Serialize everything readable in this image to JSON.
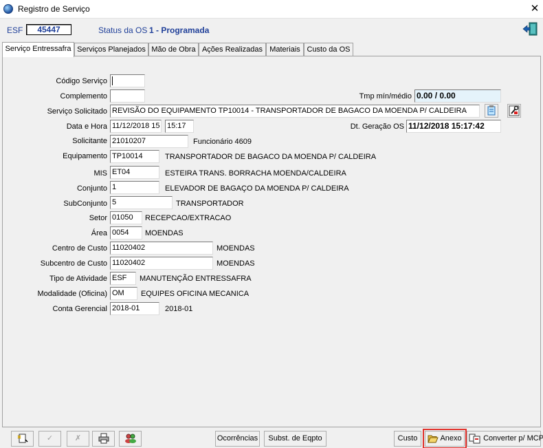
{
  "window": {
    "title": "Registro de Serviço",
    "close_glyph": "✕"
  },
  "header": {
    "type_label": "ESF",
    "os_number": "45447",
    "status_label": "Status da OS",
    "status_value": "1 - Programada"
  },
  "tabs": [
    {
      "label": "Serviço Entressafra",
      "active": true
    },
    {
      "label": "Serviços Planejados"
    },
    {
      "label": "Mão de Obra"
    },
    {
      "label": "Ações Realizadas"
    },
    {
      "label": "Materiais"
    },
    {
      "label": "Custo da OS"
    }
  ],
  "form": {
    "codigo_servico": {
      "label": "Código Serviço",
      "value": ""
    },
    "complemento": {
      "label": "Complemento",
      "value": ""
    },
    "tmp": {
      "label": "Tmp mín/médio",
      "value": "0.00 / 0.00"
    },
    "servico_solicitado": {
      "label": "Serviço Solicitado",
      "value": "REVISÃO DO EQUIPAMENTO TP10014 - TRANSPORTADOR DE BAGACO DA MOENDA P/ CALDEIRA"
    },
    "data_hora": {
      "label": "Data e Hora",
      "date": "11/12/2018 15",
      "time": "15:17"
    },
    "dt_geracao": {
      "label": "Dt. Geração OS",
      "value": "11/12/2018 15:17:42"
    },
    "solicitante": {
      "label": "Solicitante",
      "value": "21010207",
      "desc": "Funcionário 4609"
    },
    "equipamento": {
      "label": "Equipamento",
      "value": "TP10014",
      "desc": "TRANSPORTADOR DE BAGACO DA MOENDA P/ CALDEIRA"
    },
    "mis": {
      "label": "MIS",
      "value": "ET04",
      "desc": "ESTEIRA TRANS. BORRACHA MOENDA/CALDEIRA"
    },
    "conjunto": {
      "label": "Conjunto",
      "value": "1",
      "desc": "ELEVADOR DE BAGAÇO DA MOENDA P/ CALDEIRA"
    },
    "subconjunto": {
      "label": "SubConjunto",
      "value": "5",
      "desc": "TRANSPORTADOR"
    },
    "setor": {
      "label": "Setor",
      "value": "01050",
      "desc": "RECEPCAO/EXTRACAO"
    },
    "area": {
      "label": "Área",
      "value": "0054",
      "desc": "MOENDAS"
    },
    "centro_custo": {
      "label": "Centro de Custo",
      "value": "11020402",
      "desc": "MOENDAS"
    },
    "subcentro_custo": {
      "label": "Subcentro de Custo",
      "value": "11020402",
      "desc": "MOENDAS"
    },
    "tipo_atividade": {
      "label": "Tipo de Atividade",
      "value": "ESF",
      "desc": "MANUTENÇÃO  ENTRESSAFRA"
    },
    "modalidade": {
      "label": "Modalidade (Oficina)",
      "value": "OM",
      "desc": "EQUIPES OFICINA MECANICA"
    },
    "conta_gerencial": {
      "label": "Conta Gerencial",
      "value": "2018-01",
      "desc": "2018-01"
    }
  },
  "toolbar": {
    "ocorrencias": "Ocorrências",
    "subst_eqpto": "Subst. de Eqpto",
    "custo": "Custo",
    "anexo": "Anexo",
    "converter": "Converter p/ MCP"
  },
  "colors": {
    "accent_blue": "#1f3f99",
    "highlight_red": "#e0302a"
  }
}
